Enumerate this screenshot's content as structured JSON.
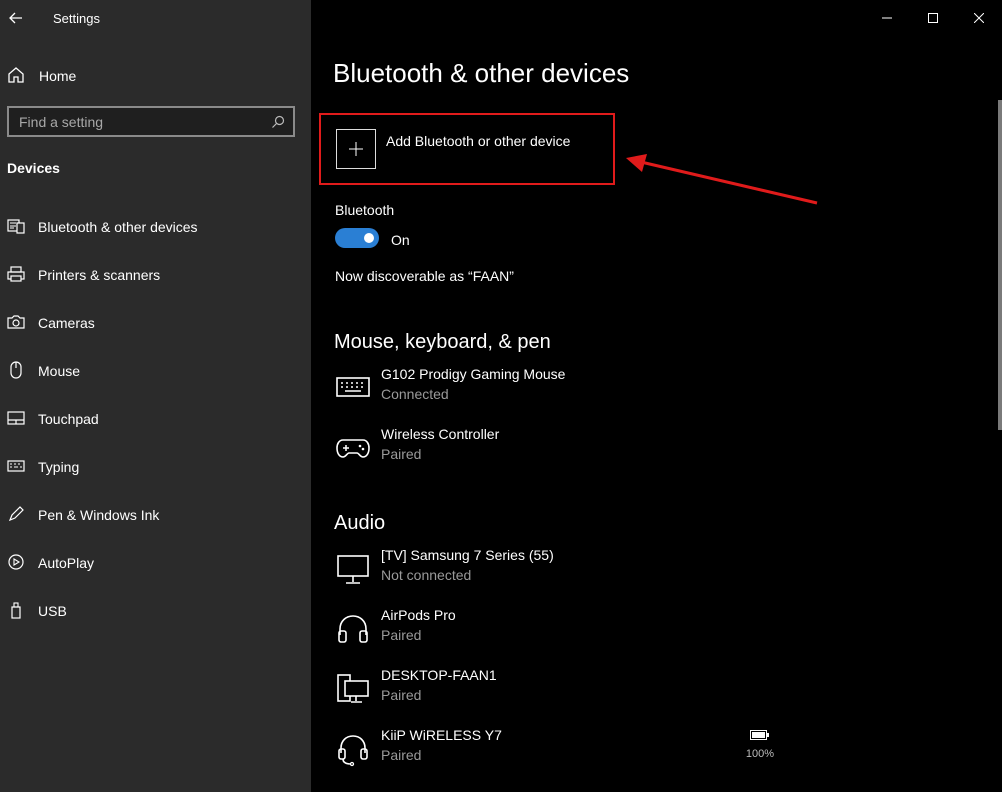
{
  "app": {
    "title": "Settings"
  },
  "sidebar": {
    "home_label": "Home",
    "search_placeholder": "Find a setting",
    "section": "Devices",
    "items": [
      {
        "label": "Bluetooth & other devices",
        "icon": "bluetooth-devices-icon"
      },
      {
        "label": "Printers & scanners",
        "icon": "printer-icon"
      },
      {
        "label": "Cameras",
        "icon": "camera-icon"
      },
      {
        "label": "Mouse",
        "icon": "mouse-icon"
      },
      {
        "label": "Touchpad",
        "icon": "touchpad-icon"
      },
      {
        "label": "Typing",
        "icon": "keyboard-icon"
      },
      {
        "label": "Pen & Windows Ink",
        "icon": "pen-icon"
      },
      {
        "label": "AutoPlay",
        "icon": "autoplay-icon"
      },
      {
        "label": "USB",
        "icon": "usb-icon"
      }
    ]
  },
  "main": {
    "title": "Bluetooth & other devices",
    "add_device_label": "Add Bluetooth or other device",
    "bluetooth_label": "Bluetooth",
    "bluetooth_state": "On",
    "discoverable_text": "Now discoverable as “FAAN”",
    "groups": [
      {
        "title": "Mouse, keyboard, & pen",
        "devices": [
          {
            "name": "G102 Prodigy Gaming Mouse",
            "status": "Connected",
            "icon": "keyboard-icon"
          },
          {
            "name": "Wireless Controller",
            "status": "Paired",
            "icon": "gamepad-icon"
          }
        ]
      },
      {
        "title": "Audio",
        "devices": [
          {
            "name": "[TV] Samsung 7 Series (55)",
            "status": "Not connected",
            "icon": "monitor-icon"
          },
          {
            "name": "AirPods Pro",
            "status": "Paired",
            "icon": "headphones-icon"
          },
          {
            "name": "DESKTOP-FAAN1",
            "status": "Paired",
            "icon": "computer-icon"
          },
          {
            "name": "KiiP WiRELESS Y7",
            "status": "Paired",
            "icon": "headset-icon",
            "battery": "100%"
          }
        ]
      }
    ]
  },
  "colors": {
    "accent": "#2a7fd4",
    "highlight_border": "#e01b1b",
    "sidebar_bg": "#2b2b2b",
    "main_bg": "#000000"
  }
}
